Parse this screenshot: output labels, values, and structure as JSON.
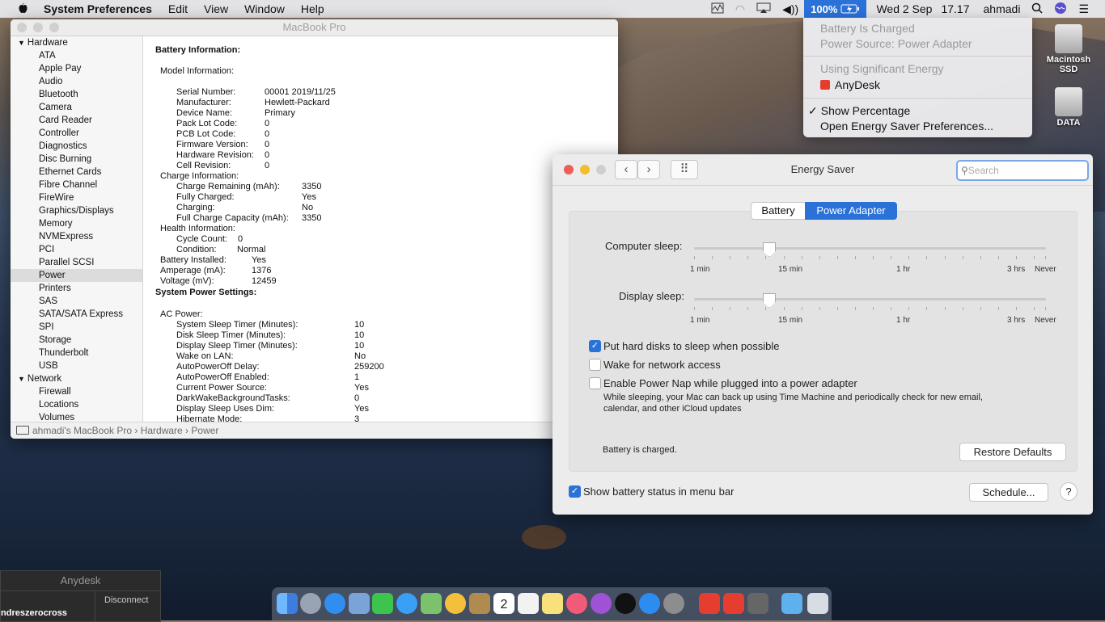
{
  "menubar": {
    "app_name": "System Preferences",
    "items": [
      "Edit",
      "View",
      "Window",
      "Help"
    ],
    "battery_pct": "100%",
    "date": "Wed 2 Sep",
    "time": "17.17",
    "user": "ahmadi"
  },
  "battery_menu": {
    "status": "Battery Is Charged",
    "source": "Power Source: Power Adapter",
    "sig_energy": "Using Significant Energy",
    "app": "AnyDesk",
    "show_pct": "Show Percentage",
    "open_prefs": "Open Energy Saver Preferences..."
  },
  "desktop": {
    "disk1": "Macintosh SSD",
    "disk2": "DATA"
  },
  "sysinfo": {
    "title": "MacBook Pro",
    "sidebar": {
      "hardware": "Hardware",
      "hw_items": [
        "ATA",
        "Apple Pay",
        "Audio",
        "Bluetooth",
        "Camera",
        "Card Reader",
        "Controller",
        "Diagnostics",
        "Disc Burning",
        "Ethernet Cards",
        "Fibre Channel",
        "FireWire",
        "Graphics/Displays",
        "Memory",
        "NVMExpress",
        "PCI",
        "Parallel SCSI",
        "Power",
        "Printers",
        "SAS",
        "SATA/SATA Express",
        "SPI",
        "Storage",
        "Thunderbolt",
        "USB"
      ],
      "network": "Network",
      "net_items": [
        "Firewall",
        "Locations",
        "Volumes"
      ]
    },
    "battery_heading": "Battery Information:",
    "model_info": "Model Information:",
    "model_rows": [
      [
        "Serial Number:",
        "00001 2019/11/25"
      ],
      [
        "Manufacturer:",
        "Hewlett-Packard"
      ],
      [
        "Device Name:",
        "Primary"
      ],
      [
        "Pack Lot Code:",
        "0"
      ],
      [
        "PCB Lot Code:",
        "0"
      ],
      [
        "Firmware Version:",
        "0"
      ],
      [
        "Hardware Revision:",
        "0"
      ],
      [
        "Cell Revision:",
        "0"
      ]
    ],
    "charge_info": "Charge Information:",
    "charge_rows": [
      [
        "Charge Remaining (mAh):",
        "3350"
      ],
      [
        "Fully Charged:",
        "Yes"
      ],
      [
        "Charging:",
        "No"
      ],
      [
        "Full Charge Capacity (mAh):",
        "3350"
      ]
    ],
    "health_info": "Health Information:",
    "health_rows": [
      [
        "Cycle Count:",
        "0"
      ],
      [
        "Condition:",
        "Normal"
      ]
    ],
    "top_rows": [
      [
        "Battery Installed:",
        "Yes"
      ],
      [
        "Amperage (mA):",
        "1376"
      ],
      [
        "Voltage (mV):",
        "12459"
      ]
    ],
    "power_heading": "System Power Settings:",
    "ac_power": "AC Power:",
    "ac_rows": [
      [
        "System Sleep Timer (Minutes):",
        "10"
      ],
      [
        "Disk Sleep Timer (Minutes):",
        "10"
      ],
      [
        "Display Sleep Timer (Minutes):",
        "10"
      ],
      [
        "Wake on LAN:",
        "No"
      ],
      [
        "AutoPowerOff Delay:",
        "259200"
      ],
      [
        "AutoPowerOff Enabled:",
        "1"
      ],
      [
        "Current Power Source:",
        "Yes"
      ],
      [
        "DarkWakeBackgroundTasks:",
        "0"
      ],
      [
        "Display Sleep Uses Dim:",
        "Yes"
      ],
      [
        "Hibernate Mode:",
        "3"
      ]
    ],
    "breadcrumb": [
      "ahmadi's MacBook Pro",
      "Hardware",
      "Power"
    ]
  },
  "energy": {
    "title": "Energy Saver",
    "search_placeholder": "Search",
    "tabs": [
      "Battery",
      "Power Adapter"
    ],
    "computer_sleep": "Computer sleep:",
    "display_sleep": "Display sleep:",
    "computer_sleep_value": "10 min",
    "display_sleep_value": "10 min",
    "ticks": [
      "1 min",
      "15 min",
      "1 hr",
      "3 hrs",
      "Never"
    ],
    "opt1": "Put hard disks to sleep when possible",
    "opt2": "Wake for network access",
    "opt3": "Enable Power Nap while plugged into a power adapter",
    "opt3_desc1": "While sleeping, your Mac can back up using Time Machine and periodically check for new email,",
    "opt3_desc2": "calendar, and other iCloud updates",
    "status": "Battery is charged.",
    "restore": "Restore Defaults",
    "show_status": "Show battery status in menu bar",
    "schedule": "Schedule...",
    "help": "?"
  },
  "anydesk": {
    "title": "Anydesk",
    "user": "ndreszerocross",
    "disconnect": "Disconnect"
  },
  "dock_calendar_day": "2",
  "colors": {
    "accent": "#2a71d8",
    "red": "#ee5d56",
    "yellow": "#f5bd2e"
  }
}
